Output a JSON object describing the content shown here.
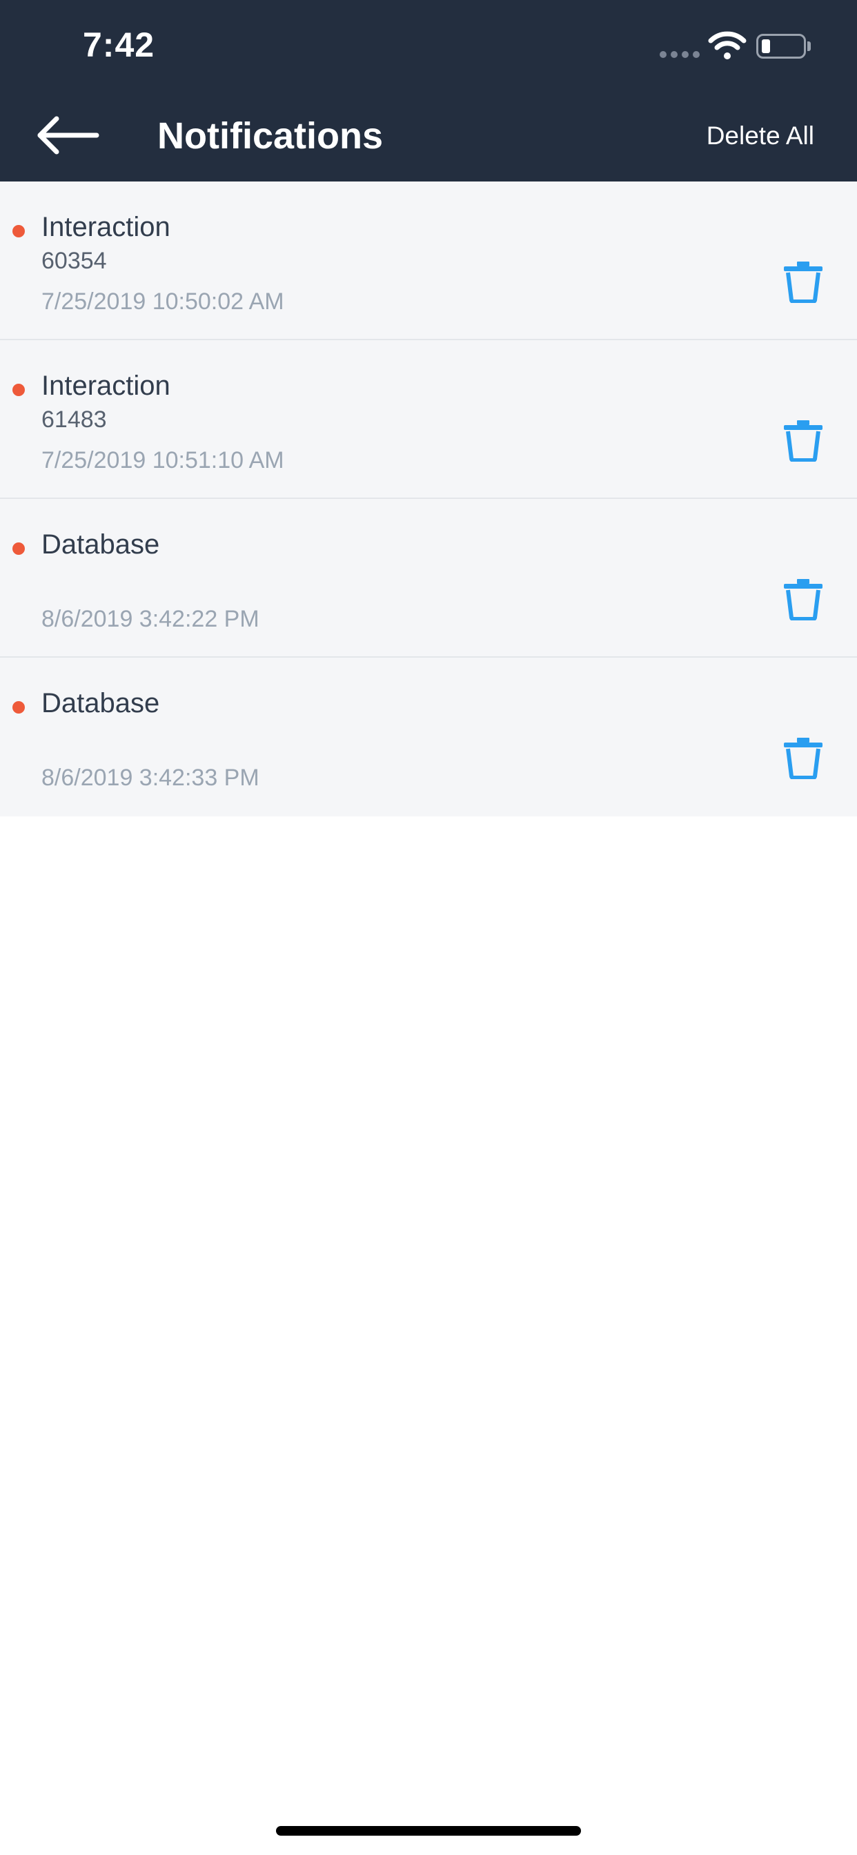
{
  "status_bar": {
    "time": "7:42",
    "battery_level": 0.2,
    "icons": [
      "signal-icon",
      "wifi-icon",
      "battery-icon"
    ]
  },
  "header": {
    "back_icon": "back-arrow-icon",
    "title": "Notifications",
    "delete_all_label": "Delete All"
  },
  "colors": {
    "header_background": "#232e3f",
    "list_background": "#f5f6f8",
    "unread_dot": "#ee5a3a",
    "trash_icon": "#2a9ef0",
    "title_text": "#323d4d",
    "timestamp_text": "#9aa5b2"
  },
  "notifications": [
    {
      "title": "Interaction",
      "subtitle": "60354",
      "timestamp": "7/25/2019 10:50:02 AM",
      "unread": true,
      "action_icon": "trash-icon"
    },
    {
      "title": "Interaction",
      "subtitle": "61483",
      "timestamp": "7/25/2019 10:51:10 AM",
      "unread": true,
      "action_icon": "trash-icon"
    },
    {
      "title": "Database",
      "subtitle": "",
      "timestamp": "8/6/2019 3:42:22 PM",
      "unread": true,
      "action_icon": "trash-icon"
    },
    {
      "title": "Database",
      "subtitle": "",
      "timestamp": "8/6/2019 3:42:33 PM",
      "unread": true,
      "action_icon": "trash-icon"
    }
  ]
}
